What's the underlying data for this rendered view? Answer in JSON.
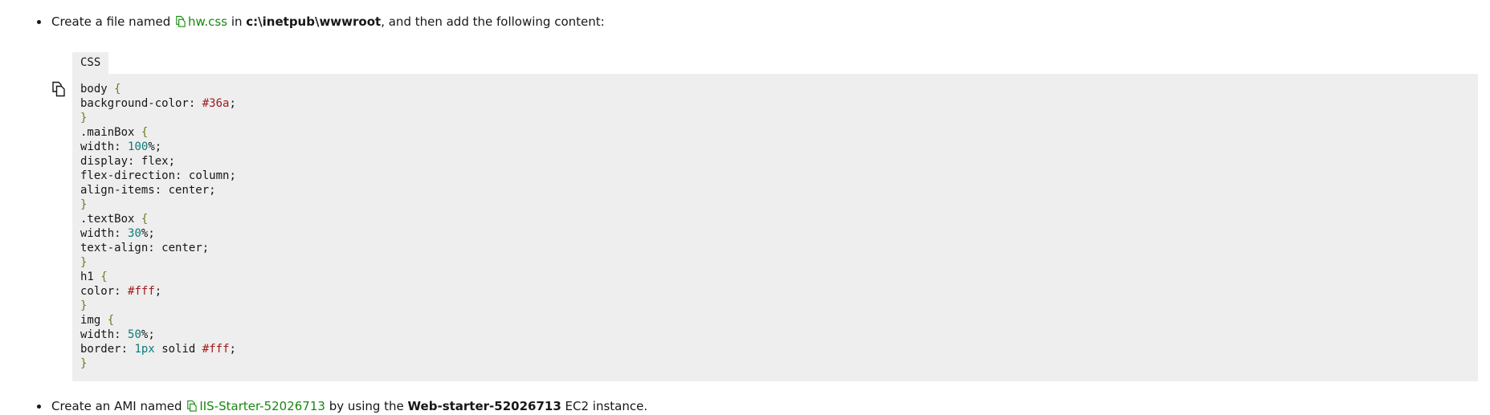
{
  "step_create_file": {
    "prefix": "Create a file named ",
    "filename": "hw.css",
    "middle": " in ",
    "path": "c:\\inetpub\\wwwroot",
    "suffix": ", and then add the following content:"
  },
  "code_block": {
    "language_tab": "CSS",
    "copy_icon": "copy-icon",
    "lines": [
      [
        [
          "sel",
          "body"
        ],
        [
          "sp",
          " "
        ],
        [
          "brace",
          "{"
        ]
      ],
      [
        [
          "prop",
          "background-color"
        ],
        [
          "colon",
          ":"
        ],
        [
          "sp",
          " "
        ],
        [
          "hex",
          "#36a"
        ],
        [
          "semi",
          ";"
        ]
      ],
      [
        [
          "brace",
          "}"
        ]
      ],
      [
        [
          "sel",
          ".mainBox"
        ],
        [
          "sp",
          " "
        ],
        [
          "brace",
          "{"
        ]
      ],
      [
        [
          "prop",
          "width"
        ],
        [
          "colon",
          ":"
        ],
        [
          "sp",
          " "
        ],
        [
          "num",
          "100"
        ],
        [
          "semi",
          "%;"
        ]
      ],
      [
        [
          "prop",
          "display"
        ],
        [
          "colon",
          ":"
        ],
        [
          "sp",
          " "
        ],
        [
          "kw",
          "flex"
        ],
        [
          "semi",
          ";"
        ]
      ],
      [
        [
          "prop",
          "flex-direction"
        ],
        [
          "colon",
          ":"
        ],
        [
          "sp",
          " "
        ],
        [
          "kw",
          "column"
        ],
        [
          "semi",
          ";"
        ]
      ],
      [
        [
          "prop",
          "align-items"
        ],
        [
          "colon",
          ":"
        ],
        [
          "sp",
          " "
        ],
        [
          "kw",
          "center"
        ],
        [
          "semi",
          ";"
        ]
      ],
      [
        [
          "brace",
          "}"
        ]
      ],
      [
        [
          "sel",
          ".textBox"
        ],
        [
          "sp",
          " "
        ],
        [
          "brace",
          "{"
        ]
      ],
      [
        [
          "prop",
          "width"
        ],
        [
          "colon",
          ":"
        ],
        [
          "sp",
          " "
        ],
        [
          "num",
          "30"
        ],
        [
          "semi",
          "%;"
        ]
      ],
      [
        [
          "prop",
          "text-align"
        ],
        [
          "colon",
          ":"
        ],
        [
          "sp",
          " "
        ],
        [
          "kw",
          "center"
        ],
        [
          "semi",
          ";"
        ]
      ],
      [
        [
          "brace",
          "}"
        ]
      ],
      [
        [
          "sel",
          "h1"
        ],
        [
          "sp",
          " "
        ],
        [
          "brace",
          "{"
        ]
      ],
      [
        [
          "prop",
          "color"
        ],
        [
          "colon",
          ":"
        ],
        [
          "sp",
          " "
        ],
        [
          "hex",
          "#fff"
        ],
        [
          "semi",
          ";"
        ]
      ],
      [
        [
          "brace",
          "}"
        ]
      ],
      [
        [
          "sel",
          "img"
        ],
        [
          "sp",
          " "
        ],
        [
          "brace",
          "{"
        ]
      ],
      [
        [
          "prop",
          "width"
        ],
        [
          "colon",
          ":"
        ],
        [
          "sp",
          " "
        ],
        [
          "num",
          "50"
        ],
        [
          "semi",
          "%;"
        ]
      ],
      [
        [
          "prop",
          "border"
        ],
        [
          "colon",
          ":"
        ],
        [
          "sp",
          " "
        ],
        [
          "num",
          "1px"
        ],
        [
          "sp",
          " "
        ],
        [
          "kw",
          "solid"
        ],
        [
          "sp",
          " "
        ],
        [
          "hex",
          "#fff"
        ],
        [
          "semi",
          ";"
        ]
      ],
      [
        [
          "brace",
          "}"
        ]
      ]
    ]
  },
  "step_create_ami": {
    "prefix": "Create an AMI named ",
    "ami_name": "IIS-Starter-52026713",
    "middle": " by using the ",
    "instance": "Web-starter-52026713",
    "suffix": " EC2 instance."
  },
  "colors": {
    "link_green": "#17890f",
    "code_background": "#eeeeee",
    "hex_red": "#a11a1a",
    "number_teal": "#0b7a7a",
    "brace_olive": "#6e7a22"
  }
}
